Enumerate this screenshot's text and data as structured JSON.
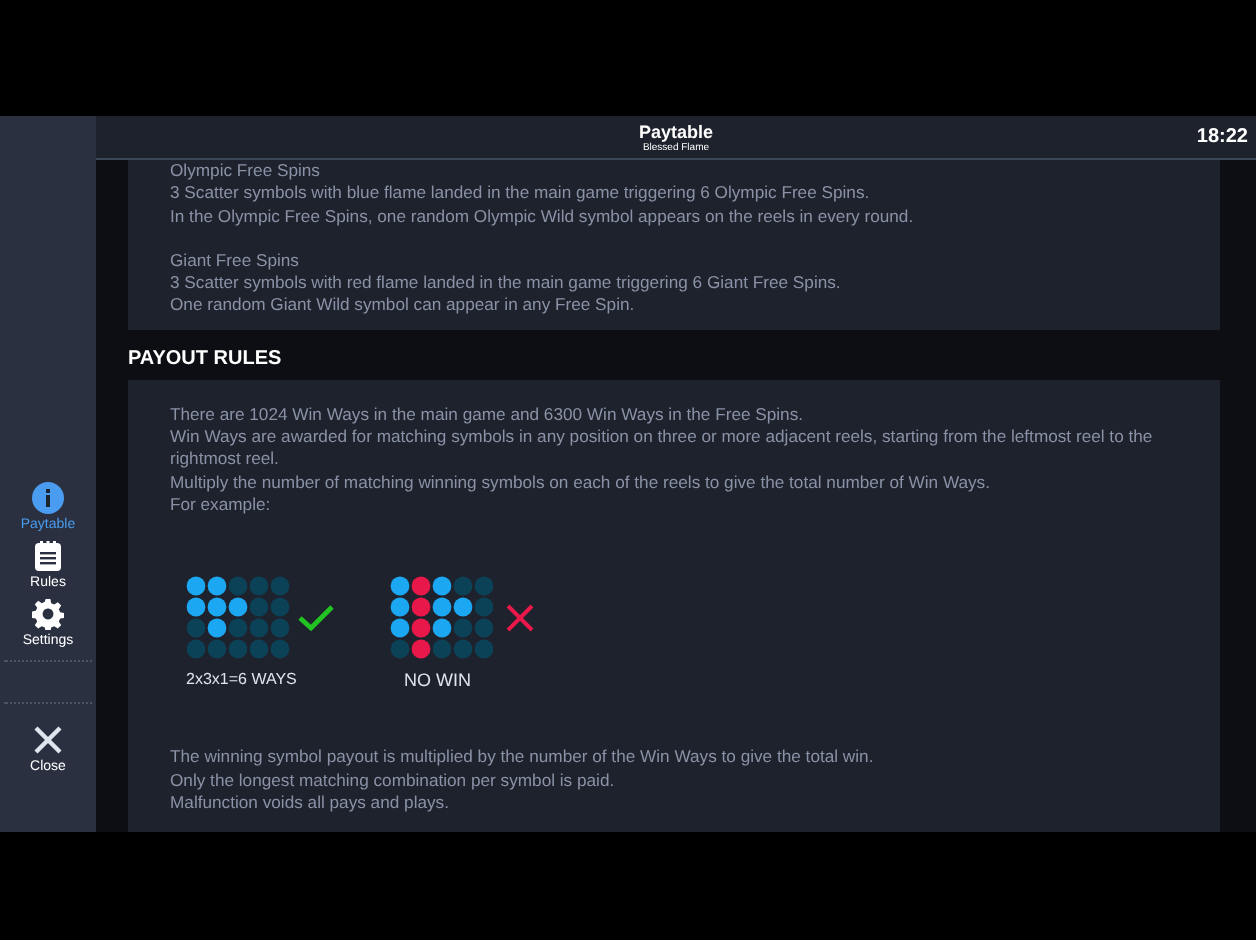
{
  "header": {
    "title": "Paytable",
    "subtitle": "Blessed Flame",
    "time": "18:22"
  },
  "sidebar": {
    "items": [
      {
        "label": "Paytable",
        "kind": "info",
        "selected": true
      },
      {
        "label": "Rules",
        "kind": "rules",
        "selected": false
      },
      {
        "label": "Settings",
        "kind": "settings",
        "selected": false
      }
    ],
    "close": {
      "label": "Close"
    }
  },
  "free_spins_panel": {
    "paragraphs": [
      [
        "Olympic Free Spins",
        "3 Scatter symbols with blue flame landed in the main game triggering 6 Olympic Free Spins.",
        "In the Olympic Free Spins, one random Olympic Wild symbol appears on the reels in every round."
      ],
      [
        "Giant Free Spins",
        "3 Scatter symbols with red flame landed in the main game triggering 6 Giant Free Spins.",
        "One random Giant Wild symbol can appear in any Free Spin."
      ]
    ]
  },
  "payout_rules": {
    "heading": "PAYOUT RULES",
    "intro": [
      "There are 1024 Win Ways in the main game and 6300 Win Ways in the Free Spins.",
      "Win Ways are awarded for matching symbols in any position on three or more adjacent reels, starting from the leftmost reel to the rightmost reel.",
      "Multiply the number of matching winning symbols on each of the reels to give the total number of Win Ways.",
      "For example:"
    ],
    "examples": [
      {
        "winning": true,
        "caption": "2x3x1=6 WAYS",
        "cells": [
          [
            {
              "color": "#1ba7f2"
            },
            {
              "color": "#1ba7f2"
            },
            {
              "color": "#0b4257"
            },
            {
              "color": "#0b4257"
            },
            {
              "color": "#0b4257"
            }
          ],
          [
            {
              "color": "#1ba7f2"
            },
            {
              "color": "#1ba7f2"
            },
            {
              "color": "#1ba7f2"
            },
            {
              "color": "#0b4257"
            },
            {
              "color": "#0b4257"
            }
          ],
          [
            {
              "color": "#0b4257"
            },
            {
              "color": "#1ba7f2"
            },
            {
              "color": "#0b4257"
            },
            {
              "color": "#0b4257"
            },
            {
              "color": "#0b4257"
            }
          ],
          [
            {
              "color": "#0b4257"
            },
            {
              "color": "#0b4257"
            },
            {
              "color": "#0b4257"
            },
            {
              "color": "#0b4257"
            },
            {
              "color": "#0b4257"
            }
          ]
        ]
      },
      {
        "winning": false,
        "caption": "NO WIN",
        "cells": [
          [
            {
              "color": "#1ba7f2"
            },
            {
              "color": "#e8194a"
            },
            {
              "color": "#1ba7f2"
            },
            {
              "color": "#0b4257"
            },
            {
              "color": "#0b4257"
            }
          ],
          [
            {
              "color": "#1ba7f2"
            },
            {
              "color": "#e8194a"
            },
            {
              "color": "#1ba7f2"
            },
            {
              "color": "#1ba7f2"
            },
            {
              "color": "#0b4257"
            }
          ],
          [
            {
              "color": "#1ba7f2"
            },
            {
              "color": "#e8194a"
            },
            {
              "color": "#1ba7f2"
            },
            {
              "color": "#0b4257"
            },
            {
              "color": "#0b4257"
            }
          ],
          [
            {
              "color": "#0b4257"
            },
            {
              "color": "#e8194a"
            },
            {
              "color": "#0b4257"
            },
            {
              "color": "#0b4257"
            },
            {
              "color": "#0b4257"
            }
          ]
        ]
      }
    ],
    "outro": [
      "The winning symbol payout is multiplied by the number of the Win Ways to give the total win.",
      "Only the longest matching combination per symbol is paid.",
      "Malfunction voids all pays and plays."
    ]
  }
}
